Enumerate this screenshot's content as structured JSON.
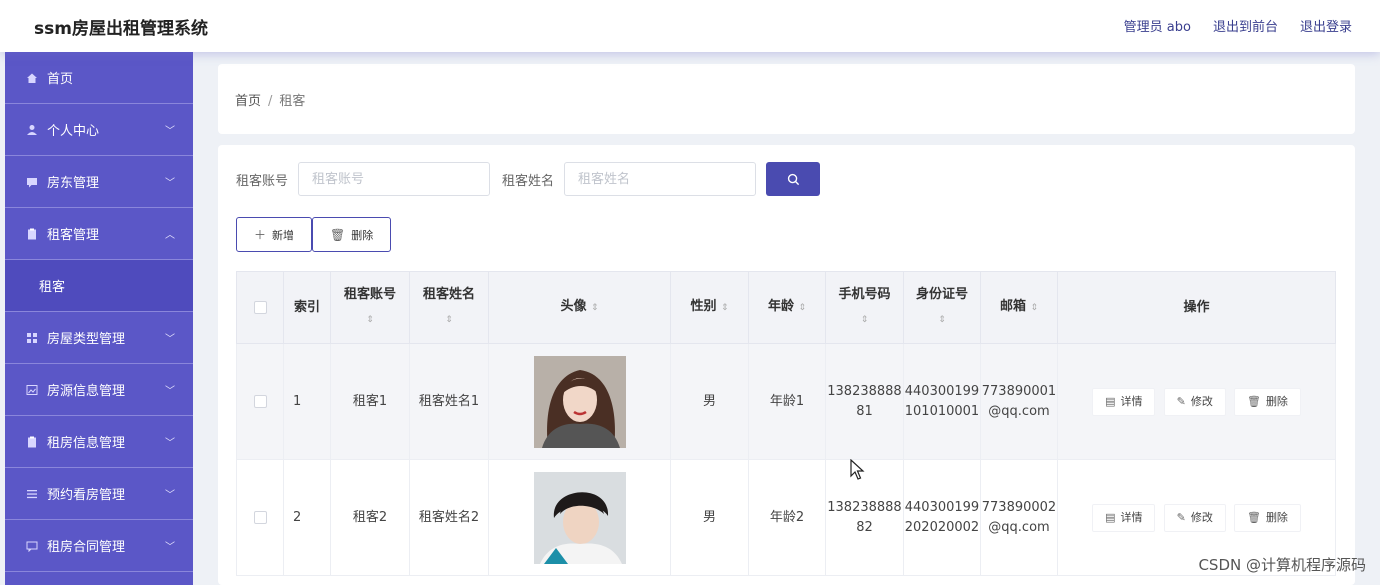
{
  "header": {
    "app_title": "ssm房屋出租管理系统",
    "admin_label": "管理员 abo",
    "to_front_label": "退出到前台",
    "logout_label": "退出登录"
  },
  "sidebar": {
    "items": [
      {
        "label": "首页",
        "icon": "home-icon"
      },
      {
        "label": "个人中心",
        "icon": "user-icon"
      },
      {
        "label": "房东管理",
        "icon": "chat-icon"
      },
      {
        "label": "租客管理",
        "icon": "clipboard-icon",
        "expanded": true,
        "sub": "租客"
      },
      {
        "label": "房屋类型管理",
        "icon": "grid-icon"
      },
      {
        "label": "房源信息管理",
        "icon": "image-icon"
      },
      {
        "label": "租房信息管理",
        "icon": "clipboard-icon"
      },
      {
        "label": "预约看房管理",
        "icon": "list-icon"
      },
      {
        "label": "租房合同管理",
        "icon": "message-icon"
      }
    ]
  },
  "breadcrumb": {
    "home": "首页",
    "sep": "/",
    "current": "租客"
  },
  "search": {
    "account_label": "租客账号",
    "account_placeholder": "租客账号",
    "name_label": "租客姓名",
    "name_placeholder": "租客姓名"
  },
  "toolbar": {
    "add_label": "新增",
    "delete_label": "删除"
  },
  "table": {
    "headers": {
      "index": "索引",
      "account": "租客账号",
      "name": "租客姓名",
      "avatar": "头像",
      "gender": "性别",
      "age": "年龄",
      "phone": "手机号码",
      "id_card": "身份证号",
      "email": "邮箱",
      "actions": "操作"
    },
    "sort_glyph": "⇕",
    "rows": [
      {
        "index": "1",
        "account": "租客1",
        "name": "租客姓名1",
        "gender": "男",
        "age": "年龄1",
        "phone": "13823888881",
        "id_card": "440300199101010001",
        "email": "773890001@qq.com"
      },
      {
        "index": "2",
        "account": "租客2",
        "name": "租客姓名2",
        "gender": "男",
        "age": "年龄2",
        "phone": "13823888882",
        "id_card": "440300199202020002",
        "email": "773890002@qq.com"
      }
    ],
    "row_actions": {
      "detail": "详情",
      "edit": "修改",
      "delete": "删除"
    }
  },
  "watermark": "CSDN @计算机程序源码",
  "colors": {
    "sidebar": "#5b57c7",
    "primary": "#4a4bb0",
    "header_link": "#3a3f8f"
  }
}
